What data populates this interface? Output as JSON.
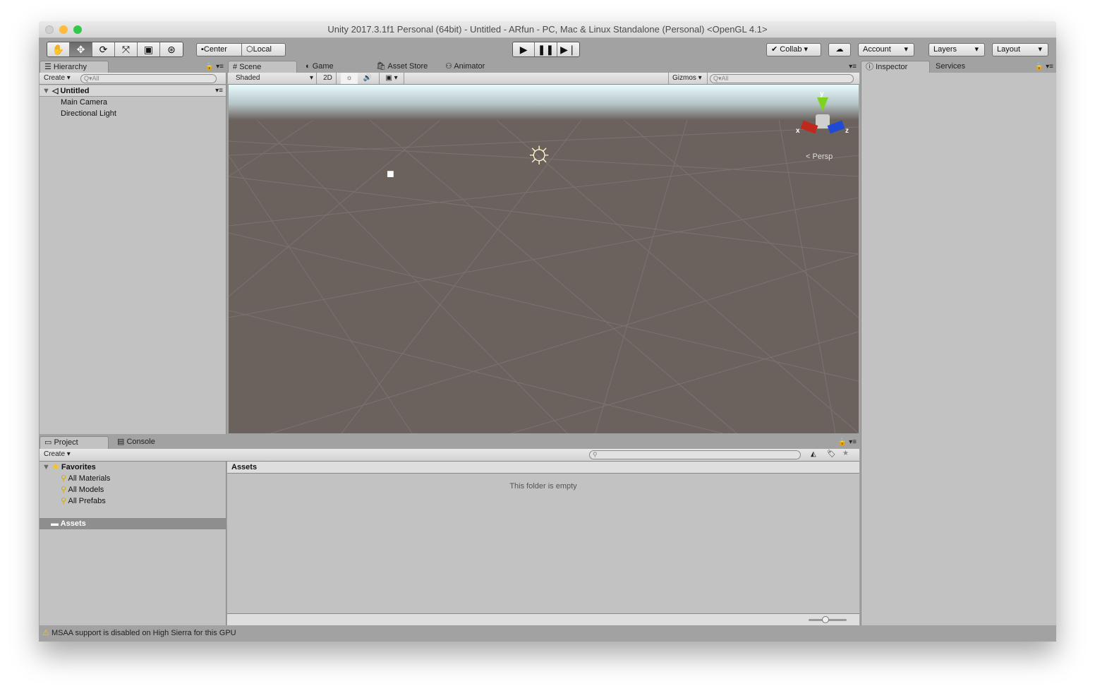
{
  "window": {
    "title": "Unity 2017.3.1f1 Personal (64bit) - Untitled - ARfun - PC, Mac & Linux Standalone (Personal) <OpenGL 4.1>"
  },
  "toolbar": {
    "tools": [
      "hand-icon",
      "move-icon",
      "rotate-icon",
      "scale-icon",
      "rect-icon",
      "transform-icon"
    ],
    "pivot": "Center",
    "space": "Local",
    "collab": "Collab",
    "account": "Account",
    "layers": "Layers",
    "layout": "Layout"
  },
  "hierarchy": {
    "tab": "Hierarchy",
    "create": "Create",
    "search_placeholder": "All",
    "scene": "Untitled",
    "items": [
      "Main Camera",
      "Directional Light"
    ]
  },
  "scene_tabs": [
    "Scene",
    "Game",
    "Asset Store",
    "Animator"
  ],
  "scene": {
    "shading": "Shaded",
    "mode_2d": "2D",
    "gizmos": "Gizmos",
    "search_placeholder": "All",
    "axis_x": "x",
    "axis_y": "y",
    "axis_z": "z",
    "projection": "Persp"
  },
  "inspector": {
    "tabs": [
      "Inspector",
      "Services"
    ]
  },
  "project": {
    "tabs": [
      "Project",
      "Console"
    ],
    "create": "Create",
    "favorites": "Favorites",
    "favorite_items": [
      "All Materials",
      "All Models",
      "All Prefabs"
    ],
    "assets_folder": "Assets",
    "breadcrumb": "Assets",
    "empty_message": "This folder is empty",
    "icon_size": 0.45
  },
  "status": {
    "message": "MSAA support is disabled on High Sierra for this GPU"
  },
  "colors": {
    "close": "#fc605c",
    "minimize": "#fdbc40",
    "zoom": "#34c84a"
  }
}
